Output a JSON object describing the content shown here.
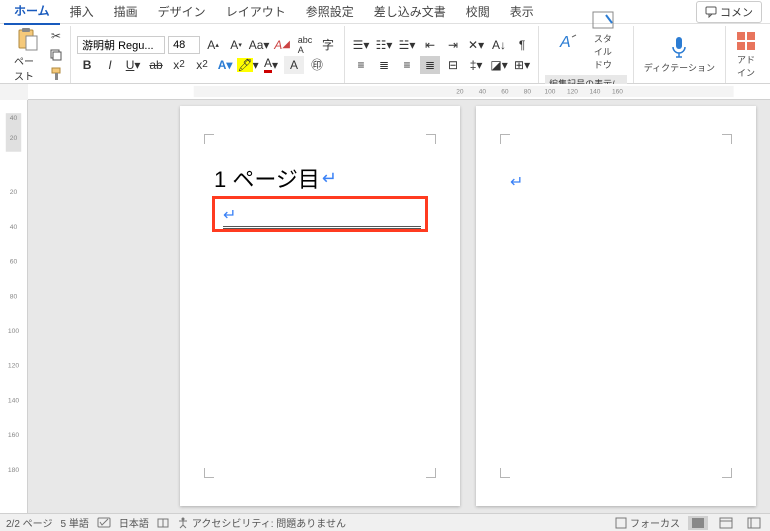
{
  "tabs": {
    "home": "ホーム",
    "insert": "挿入",
    "draw": "描画",
    "design": "デザイン",
    "layout": "レイアウト",
    "references": "参照設定",
    "mailings": "差し込み文書",
    "review": "校閲",
    "view": "表示"
  },
  "comment_btn": "コメン",
  "clipboard": {
    "paste": "ペースト"
  },
  "font": {
    "name": "游明朝 Regu...",
    "size": "48"
  },
  "edit_marks": "編集記号の表示/非表示",
  "styles": "スタ\nイル\nドウ",
  "dictation": "ディクテーション",
  "addins": "アド\nイン",
  "ruler_h": [
    "20",
    "40",
    "60",
    "80",
    "100",
    "120",
    "140",
    "160"
  ],
  "ruler_v": [
    "20",
    "40",
    "60",
    "80",
    "100",
    "120",
    "140",
    "160",
    "180"
  ],
  "ruler_v_top": [
    "40",
    "20"
  ],
  "page1": {
    "heading": "1 ページ目"
  },
  "statusbar": {
    "page": "2/2 ページ",
    "words": "5 単語",
    "lang": "日本語",
    "a11y": "アクセシビリティ: 問題ありません",
    "focus": "フォーカス"
  }
}
